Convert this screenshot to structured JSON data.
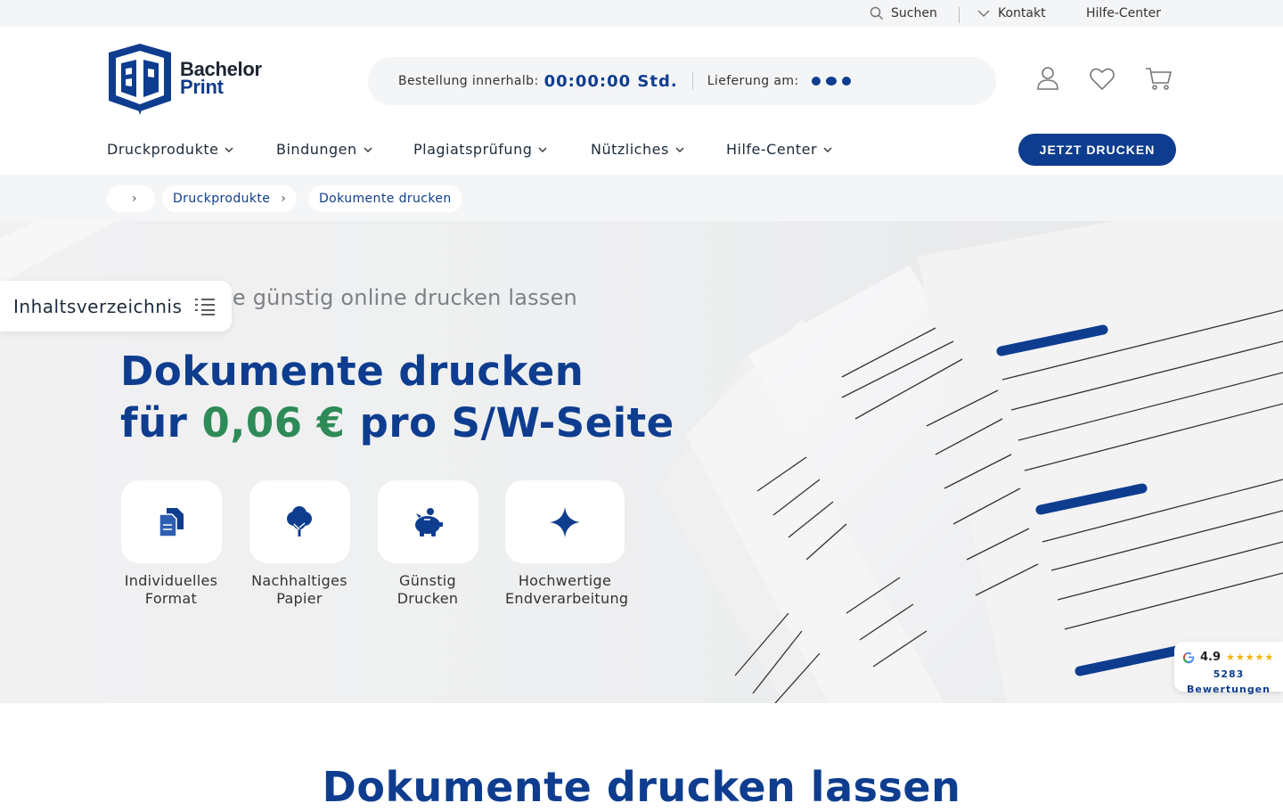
{
  "topbar": {
    "search_label": "Suchen",
    "contact_label": "Kontakt",
    "help_label": "Hilfe-Center"
  },
  "logo": {
    "line1": "Bachelor",
    "line2": "Print"
  },
  "order": {
    "label": "Bestellung innerhalb:",
    "timer": "00:00:00 Std.",
    "delivery_label": "Lieferung am:"
  },
  "nav": {
    "items": [
      "Druckprodukte",
      "Bindungen",
      "Plagiatsprüfung",
      "Nützliches",
      "Hilfe-Center"
    ],
    "cta": "JETZT DRUCKEN"
  },
  "breadcrumb": {
    "home_icon": "",
    "items": [
      "Druckprodukte",
      "Dokumente drucken"
    ]
  },
  "toc": {
    "label": "Inhaltsverzeichnis"
  },
  "hero": {
    "subtitle": "Dokumente günstig online drucken lassen",
    "title_line1": "Dokumente drucken",
    "title_line2_a": "für",
    "price": "0,06 €",
    "title_line2_b": "pro S/W-Seite",
    "features": [
      {
        "icon": "document-copy-icon",
        "line1": "Individuelles",
        "line2": "Format"
      },
      {
        "icon": "tree-icon",
        "line1": "Nachhaltiges",
        "line2": "Papier"
      },
      {
        "icon": "piggy-bank-icon",
        "line1": "Günstig",
        "line2": "Drucken"
      },
      {
        "icon": "sparkle-icon",
        "line1": "Hochwertige",
        "line2": "Endverarbeitung"
      }
    ]
  },
  "rating": {
    "score": "4.9",
    "stars": "★★★★★",
    "count": "5283",
    "count_label": "Bewertungen"
  },
  "section": {
    "title": "Dokumente drucken lassen"
  },
  "colors": {
    "brand_blue": "#0e3d8f",
    "price_green": "#2e8b57",
    "bg_gray": "#f4f5f7"
  }
}
